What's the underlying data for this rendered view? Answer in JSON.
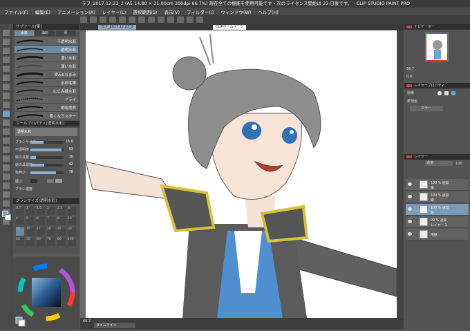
{
  "titlebar": {
    "title": "ラフ_2017.12.23_2 (A5 14.80 × 21.00cm 300dpi 66.7%)  現在全ての機能を使用可能です・次のライセンス開始は 23 日後です。 - CLIP STUDIO PAINT PRO"
  },
  "menu": [
    "ファイル(F)",
    "編集(E)",
    "アニメーション(A)",
    "レイヤー(L)",
    "選択範囲(S)",
    "表示(V)",
    "フィルター(I)",
    "ウィンドウ(W)",
    "ヘルプ(H)"
  ],
  "canvas_tabs": {
    "tab1": "ラフ_2017.12.23_2",
    "url": "CLIPホームページ"
  },
  "sub_tool": {
    "header": "サブツール[筆]",
    "tabs": [
      "水彩",
      "油彩",
      "厚"
    ],
    "brushes": [
      "不透明水彩",
      "透明水彩",
      "濃い水彩",
      "薄い水彩",
      "滲み&なまみ",
      "水彩毛筆",
      "にじみ縁水彩",
      "ドライ",
      "明暗境界",
      "粗くなラスター"
    ]
  },
  "tool_property": {
    "header": "ツールプロパティ[透明水彩]",
    "name": "透明水彩",
    "rows": [
      {
        "label": "ブラシサイズ",
        "value": "15.0",
        "level": 0.4
      },
      {
        "label": "不透明度",
        "value": "93",
        "level": 0.93
      },
      {
        "label": "絵の具量",
        "value": "16",
        "level": 0.16
      },
      {
        "label": "絵の具濃度",
        "value": "42",
        "level": 0.42
      },
      {
        "label": "色伸び",
        "value": "78",
        "level": 0.78
      }
    ],
    "texture_label": "硬さ",
    "density_label": "ブラシ濃度"
  },
  "brush_size": {
    "header": "ブラシサイズ[透明水彩]",
    "row1": [
      "0.7",
      "1",
      "1.5",
      "2",
      "2.5",
      "3"
    ],
    "row2": [
      "4",
      "5",
      "6",
      "7",
      "8",
      "10"
    ],
    "row3": [
      "12",
      "15",
      "17",
      "20",
      "25",
      "30"
    ],
    "row4": [
      "40",
      "50",
      "60",
      "70",
      "80",
      "100"
    ]
  },
  "navigator": {
    "header": "ナビゲーター",
    "zoom": "66.7",
    "angle": "0.0"
  },
  "layer_property": {
    "header": "レイヤープロパティ",
    "effect_label": "効果",
    "display_color_label": "表現色",
    "display_color": "カラー"
  },
  "layers": {
    "header": "レイヤー",
    "blend": "通常",
    "opacity": "100",
    "items": [
      {
        "title": "100 % 通常",
        "name": "瞳"
      },
      {
        "title": "100 % 通常",
        "name": "縁"
      },
      {
        "title": "100 % 通常",
        "name": "色"
      },
      {
        "title": "29 % 通常",
        "name": "レイヤー 1"
      },
      {
        "title": "",
        "name": "用紙"
      }
    ]
  },
  "timeline_tab": "タイムライン",
  "status": {
    "zoom": "66.7"
  },
  "colors": {
    "accent": "#6fa3c9",
    "panel": "#535353",
    "header": "#2f2f2f"
  }
}
